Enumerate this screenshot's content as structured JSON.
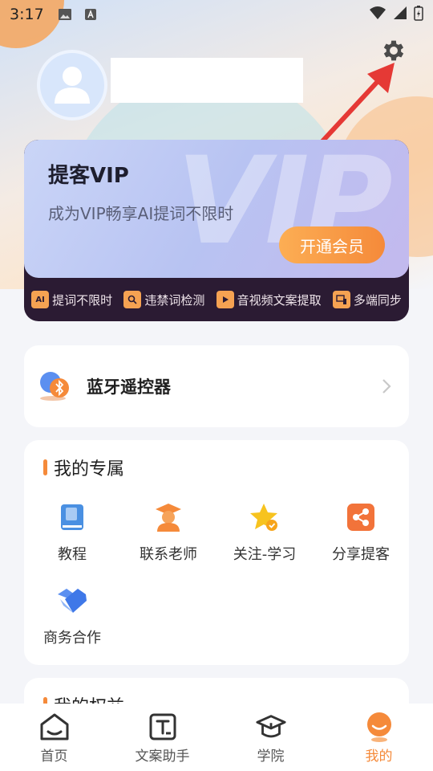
{
  "status_bar": {
    "time": "3:17"
  },
  "vip": {
    "title": "提客VIP",
    "subtitle": "成为VIP畅享AI提词不限时",
    "watermark": "VIP",
    "button": "开通会员",
    "features": [
      {
        "icon": "unlimited-prompt-icon",
        "label": "提词不限时"
      },
      {
        "icon": "banned-word-check-icon",
        "label": "违禁词检测"
      },
      {
        "icon": "av-extract-icon",
        "label": "音视频文案提取"
      },
      {
        "icon": "multi-device-icon",
        "label": "多端同步"
      }
    ]
  },
  "bluetooth": {
    "label": "蓝牙遥控器"
  },
  "exclusive": {
    "title": "我的专属",
    "items": [
      {
        "icon": "book-icon",
        "label": "教程"
      },
      {
        "icon": "teacher-icon",
        "label": "联系老师"
      },
      {
        "icon": "star-icon",
        "label": "关注-学习"
      },
      {
        "icon": "share-icon",
        "label": "分享提客"
      },
      {
        "icon": "handshake-icon",
        "label": "商务合作"
      }
    ]
  },
  "equity": {
    "title": "我的权益"
  },
  "nav": {
    "items": [
      {
        "icon": "home-icon",
        "label": "首页"
      },
      {
        "icon": "copywriting-icon",
        "label": "文案助手"
      },
      {
        "icon": "academy-icon",
        "label": "学院"
      },
      {
        "icon": "me-icon",
        "label": "我的"
      }
    ],
    "active_color": "#F58A3A"
  }
}
